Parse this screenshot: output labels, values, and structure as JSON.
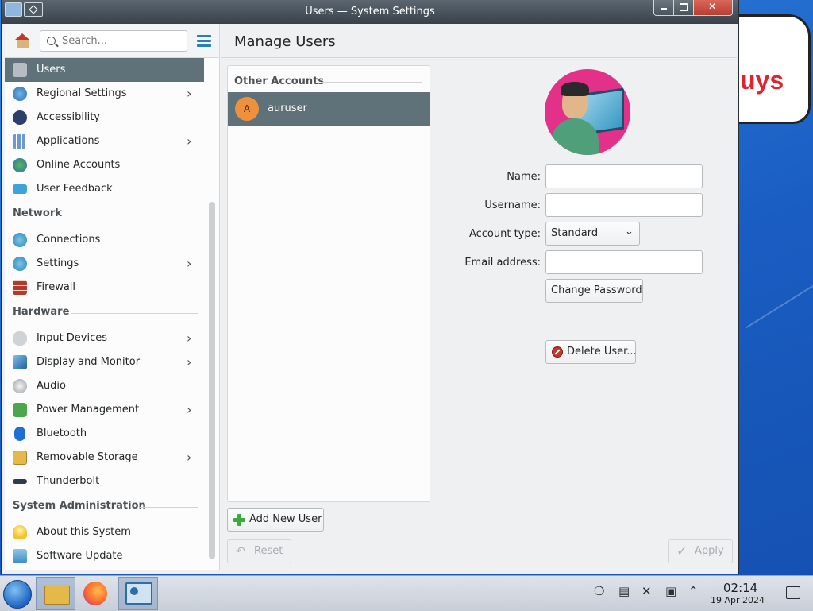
{
  "window": {
    "title": "Users — System Settings"
  },
  "sidebar": {
    "search_placeholder": "Search...",
    "items": [
      {
        "label": "Users",
        "icon": "users-icon",
        "active": true
      },
      {
        "label": "Regional Settings",
        "icon": "globe-icon",
        "has_children": true
      },
      {
        "label": "Accessibility",
        "icon": "accessibility-icon"
      },
      {
        "label": "Applications",
        "icon": "applications-icon",
        "has_children": true
      },
      {
        "label": "Online Accounts",
        "icon": "online-accounts-icon"
      },
      {
        "label": "User Feedback",
        "icon": "feedback-icon"
      }
    ],
    "sections": [
      {
        "title": "Network",
        "items": [
          {
            "label": "Connections",
            "icon": "network-globe-icon"
          },
          {
            "label": "Settings",
            "icon": "network-settings-icon",
            "has_children": true
          },
          {
            "label": "Firewall",
            "icon": "firewall-icon"
          }
        ]
      },
      {
        "title": "Hardware",
        "items": [
          {
            "label": "Input Devices",
            "icon": "mouse-icon",
            "has_children": true
          },
          {
            "label": "Display and Monitor",
            "icon": "monitor-icon",
            "has_children": true
          },
          {
            "label": "Audio",
            "icon": "speaker-icon"
          },
          {
            "label": "Power Management",
            "icon": "power-plug-icon",
            "has_children": true
          },
          {
            "label": "Bluetooth",
            "icon": "bluetooth-icon"
          },
          {
            "label": "Removable Storage",
            "icon": "folder-icon",
            "has_children": true
          },
          {
            "label": "Thunderbolt",
            "icon": "thunderbolt-icon"
          }
        ]
      },
      {
        "title": "System Administration",
        "items": [
          {
            "label": "About this System",
            "icon": "lightbulb-icon"
          },
          {
            "label": "Software Update",
            "icon": "software-update-icon"
          }
        ]
      }
    ]
  },
  "main": {
    "title": "Manage Users",
    "accounts_header": "Other Accounts",
    "accounts": [
      {
        "initial": "A",
        "name": "auruser"
      }
    ],
    "form": {
      "name_label": "Name:",
      "name_value": "",
      "username_label": "Username:",
      "username_value": "",
      "account_type_label": "Account type:",
      "account_type_value": "Standard",
      "email_label": "Email address:",
      "email_value": "",
      "change_password": "Change Password",
      "delete_user": "Delete User..."
    },
    "add_user": "Add New User",
    "reset": "Reset",
    "apply": "Apply"
  },
  "taskbar": {
    "time": "02:14",
    "date": "19 Apr 2024"
  },
  "wallpaper_text": "uys"
}
